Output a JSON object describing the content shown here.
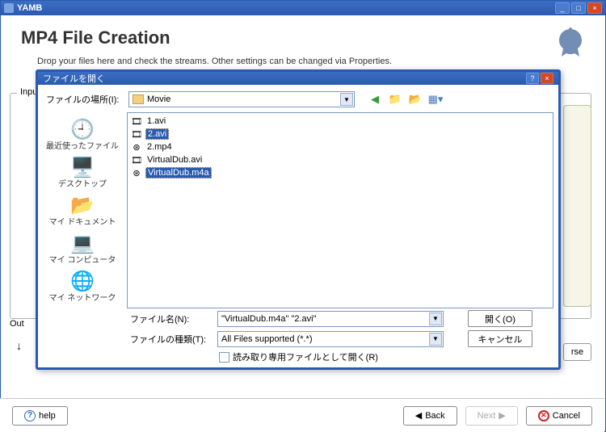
{
  "window": {
    "title": "YAMB",
    "min": "_",
    "max": "□",
    "close": "×"
  },
  "page": {
    "title": "MP4 File Creation",
    "subtitle": "Drop your files here and check the streams. Other settings can be changed via Properties."
  },
  "groups": {
    "input_legend": "Inpu",
    "output_legend": "Out",
    "rse": "rse"
  },
  "bottom": {
    "help": "help",
    "back": "Back",
    "next": "Next",
    "cancel": "Cancel",
    "back_arrow": "◀",
    "next_arrow": "▶",
    "cancel_x": "✕"
  },
  "dialog": {
    "title": "ファイルを開く",
    "help": "?",
    "close": "×",
    "lookin_label": "ファイルの場所(I):",
    "lookin_value": "Movie",
    "toolbar": {
      "back": "←",
      "up": "📁",
      "new": "📂✱",
      "views": "▦▾"
    },
    "places": [
      {
        "icon": "🕘",
        "label": "最近使ったファイル"
      },
      {
        "icon": "🖥️",
        "label": "デスクトップ"
      },
      {
        "icon": "📂",
        "label": "マイ ドキュメント"
      },
      {
        "icon": "💻",
        "label": "マイ コンピュータ"
      },
      {
        "icon": "🌐",
        "label": "マイ ネットワーク"
      }
    ],
    "files": [
      {
        "icon": "🎞",
        "name": "1.avi",
        "selected": false
      },
      {
        "icon": "🎞",
        "name": "2.avi",
        "selected": true
      },
      {
        "icon": "⊛",
        "name": "2.mp4",
        "selected": false
      },
      {
        "icon": "🎞",
        "name": "VirtualDub.avi",
        "selected": false
      },
      {
        "icon": "⊛",
        "name": "VirtualDub.m4a",
        "selected": true
      }
    ],
    "filename_label": "ファイル名(N):",
    "filename_value": "\"VirtualDub.m4a\" \"2.avi\"",
    "filetype_label": "ファイルの種類(T):",
    "filetype_value": "All Files supported (*.*)",
    "readonly_label": "読み取り専用ファイルとして開く(R)",
    "open_btn": "開く(O)",
    "cancel_btn": "キャンセル"
  }
}
